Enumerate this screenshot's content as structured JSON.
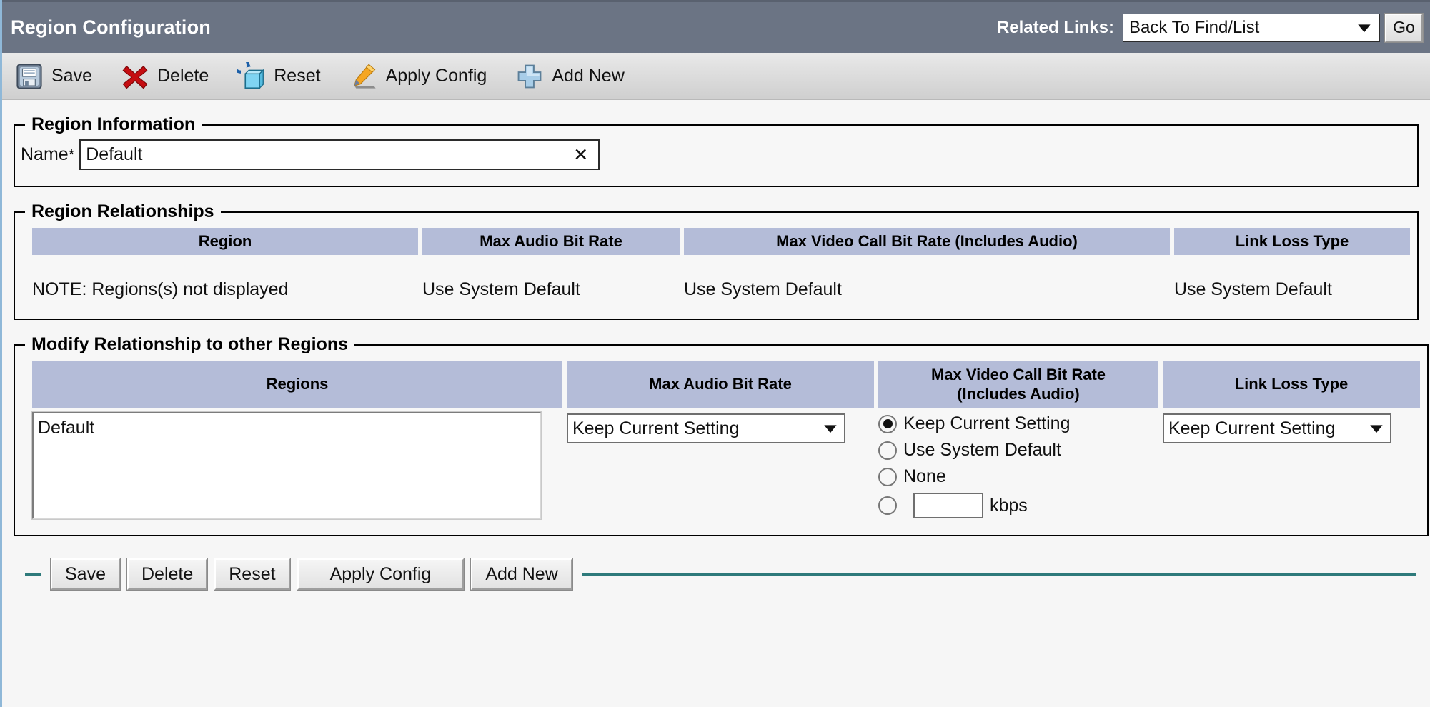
{
  "header": {
    "title": "Region Configuration",
    "related_links_label": "Related Links:",
    "related_links_value": "Back To Find/List",
    "go_label": "Go"
  },
  "toolbar": {
    "items": [
      {
        "label": "Save",
        "icon": "floppy-disk-icon"
      },
      {
        "label": "Delete",
        "icon": "red-x-icon"
      },
      {
        "label": "Reset",
        "icon": "reset-cube-icon"
      },
      {
        "label": "Apply Config",
        "icon": "pencil-icon"
      },
      {
        "label": "Add New",
        "icon": "blue-plus-icon"
      }
    ]
  },
  "region_information": {
    "legend": "Region Information",
    "name_label": "Name",
    "required_marker": "*",
    "name_value": "Default",
    "clear_icon": "✕"
  },
  "region_relationships": {
    "legend": "Region Relationships",
    "columns": [
      "Region",
      "Max Audio Bit Rate",
      "Max Video Call Bit Rate (Includes Audio)",
      "Link Loss Type"
    ],
    "rows": [
      [
        "NOTE: Regions(s) not displayed",
        "Use System Default",
        "Use System Default",
        "Use System Default"
      ]
    ]
  },
  "modify_relationship": {
    "legend": "Modify Relationship to other Regions",
    "columns": [
      "Regions",
      "Max Audio Bit Rate",
      "Max Video Call Bit Rate\n(Includes Audio)",
      "Link Loss Type"
    ],
    "col3_line1": "Max Video Call Bit Rate",
    "col3_line2": "(Includes Audio)",
    "regions_list": [
      "Default"
    ],
    "max_audio_bit_rate_value": "Keep Current Setting",
    "video_options": [
      {
        "label": "Keep Current Setting",
        "selected": true
      },
      {
        "label": "Use System Default",
        "selected": false
      },
      {
        "label": "None",
        "selected": false
      },
      {
        "label": "",
        "selected": false,
        "input_value": "",
        "suffix": "kbps"
      }
    ],
    "kbps_suffix": "kbps",
    "kbps_value": "",
    "link_loss_type_value": "Keep Current Setting"
  },
  "bottom_buttons": [
    {
      "label": "Save"
    },
    {
      "label": "Delete"
    },
    {
      "label": "Reset"
    },
    {
      "label": "Apply Config"
    },
    {
      "label": "Add New"
    }
  ],
  "colors": {
    "header_bar": "#6b7484",
    "table_header": "#b4bcd8",
    "toolbar_top": "#e9e9e9",
    "toolbar_bottom": "#cfcfcf",
    "accent_rule": "#2e7a7b",
    "page_background": "#f6f6f6"
  }
}
